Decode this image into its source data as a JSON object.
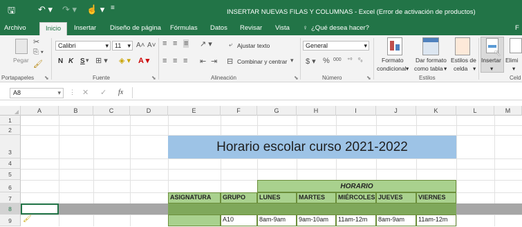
{
  "window": {
    "title": "INSERTAR NUEVAS FILAS Y COLUMNAS - Excel (Error de activación de productos)",
    "right_letter": "F"
  },
  "tabs": [
    "Archivo",
    "Inicio",
    "Insertar",
    "Diseño de página",
    "Fórmulas",
    "Datos",
    "Revisar",
    "Vista"
  ],
  "tell_me": "¿Qué desea hacer?",
  "ribbon": {
    "paste": "Pegar",
    "font_name": "Calibri",
    "font_size": "11",
    "bold": "N",
    "italic": "K",
    "underline": "S",
    "wrap_text": "Ajustar texto",
    "merge_center": "Combinar y centrar",
    "number_format": "General",
    "cond_format_1": "Formato",
    "cond_format_2": "condicional",
    "format_table_1": "Dar formato",
    "format_table_2": "como tabla",
    "cell_styles_1": "Estilos de",
    "cell_styles_2": "celda",
    "insert": "Insertar",
    "delete": "Elimi",
    "groups": {
      "clipboard": "Portapapeles",
      "font": "Fuente",
      "alignment": "Alineación",
      "number": "Número",
      "styles": "Estilos",
      "cells": "Celd"
    }
  },
  "formula_bar": {
    "name_box": "A8",
    "fx": "fx",
    "value": ""
  },
  "columns": [
    "A",
    "B",
    "C",
    "D",
    "E",
    "F",
    "G",
    "H",
    "I",
    "J",
    "K",
    "L",
    "M"
  ],
  "rows": [
    "1",
    "2",
    "3",
    "4",
    "5",
    "6",
    "7",
    "8",
    "9"
  ],
  "sheet": {
    "title": "Horario escolar curso 2021-2022",
    "horario": "HORARIO",
    "headers": [
      "ASIGNATURA",
      "GRUPO",
      "LUNES",
      "MARTES",
      "MIÉRCOLES",
      "JUEVES",
      "VIERNES"
    ],
    "row9": [
      "",
      "A10",
      "8am-9am",
      "9am-10am",
      "11am-12m",
      "8am-9am",
      "11am-12m"
    ]
  },
  "colors": {
    "excel_green": "#227447",
    "title_fill": "#9dc3e6",
    "green_fill": "#a9d18e",
    "selected_row": "#a6a6a6"
  }
}
